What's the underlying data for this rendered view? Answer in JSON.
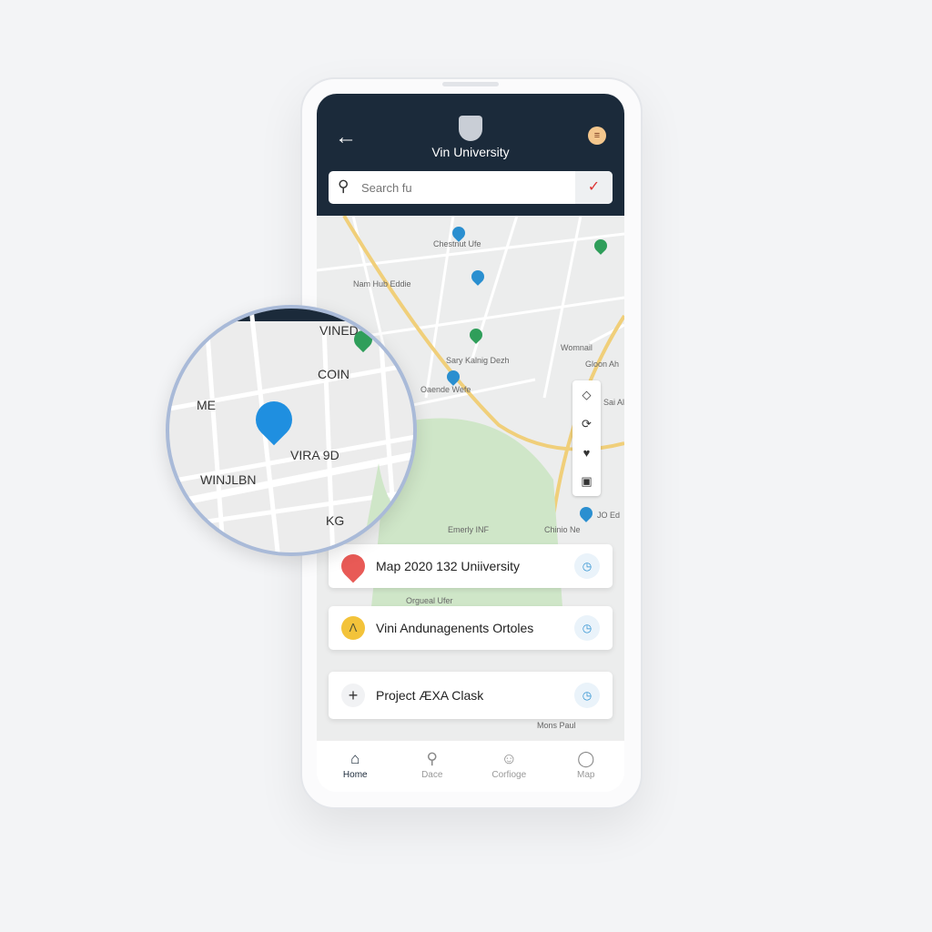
{
  "header": {
    "title": "Vin University",
    "back_icon": "arrow-left-icon",
    "logo": "university-crest"
  },
  "search": {
    "placeholder": "Search fu"
  },
  "map": {
    "labels": [
      "Chestnut Ufe",
      "Nam Hub Eddie",
      "Sary Kalnig Dezh",
      "Oaende Wefe",
      "Emerly INF",
      "Chinio Ne",
      "JO Ed",
      "Gloon Ah",
      "Sai Al",
      "Womnail",
      "Orgueal Ufer",
      "Mons Paul"
    ],
    "controls": [
      "layers-icon",
      "locate-icon",
      "heart-icon",
      "square-icon"
    ]
  },
  "magnifier": {
    "labels": [
      "VINED",
      "COIN",
      "ME",
      "VIRA 9D",
      "WINJLBN",
      "KG"
    ]
  },
  "cards": [
    {
      "label": "Map 2020 132 Uniiversity",
      "icon": "red-pin-icon",
      "action_icon": "compass-icon"
    },
    {
      "label": "Vini Andunagenents Ortoles",
      "icon": "yellow-badge-icon",
      "action_icon": "compass-icon"
    },
    {
      "label": "Project ÆXA Clask",
      "icon": "plus-icon",
      "action_icon": "compass-icon"
    }
  ],
  "nav": [
    {
      "label": "Home",
      "icon": "home-icon",
      "active": true
    },
    {
      "label": "Dace",
      "icon": "search-icon"
    },
    {
      "label": "Corfioge",
      "icon": "face-icon"
    },
    {
      "label": "Map",
      "icon": "circle-icon"
    }
  ],
  "colors": {
    "header": "#1b2a3a",
    "accent": "#2a8fd0",
    "pin_green": "#2f9e5a"
  }
}
